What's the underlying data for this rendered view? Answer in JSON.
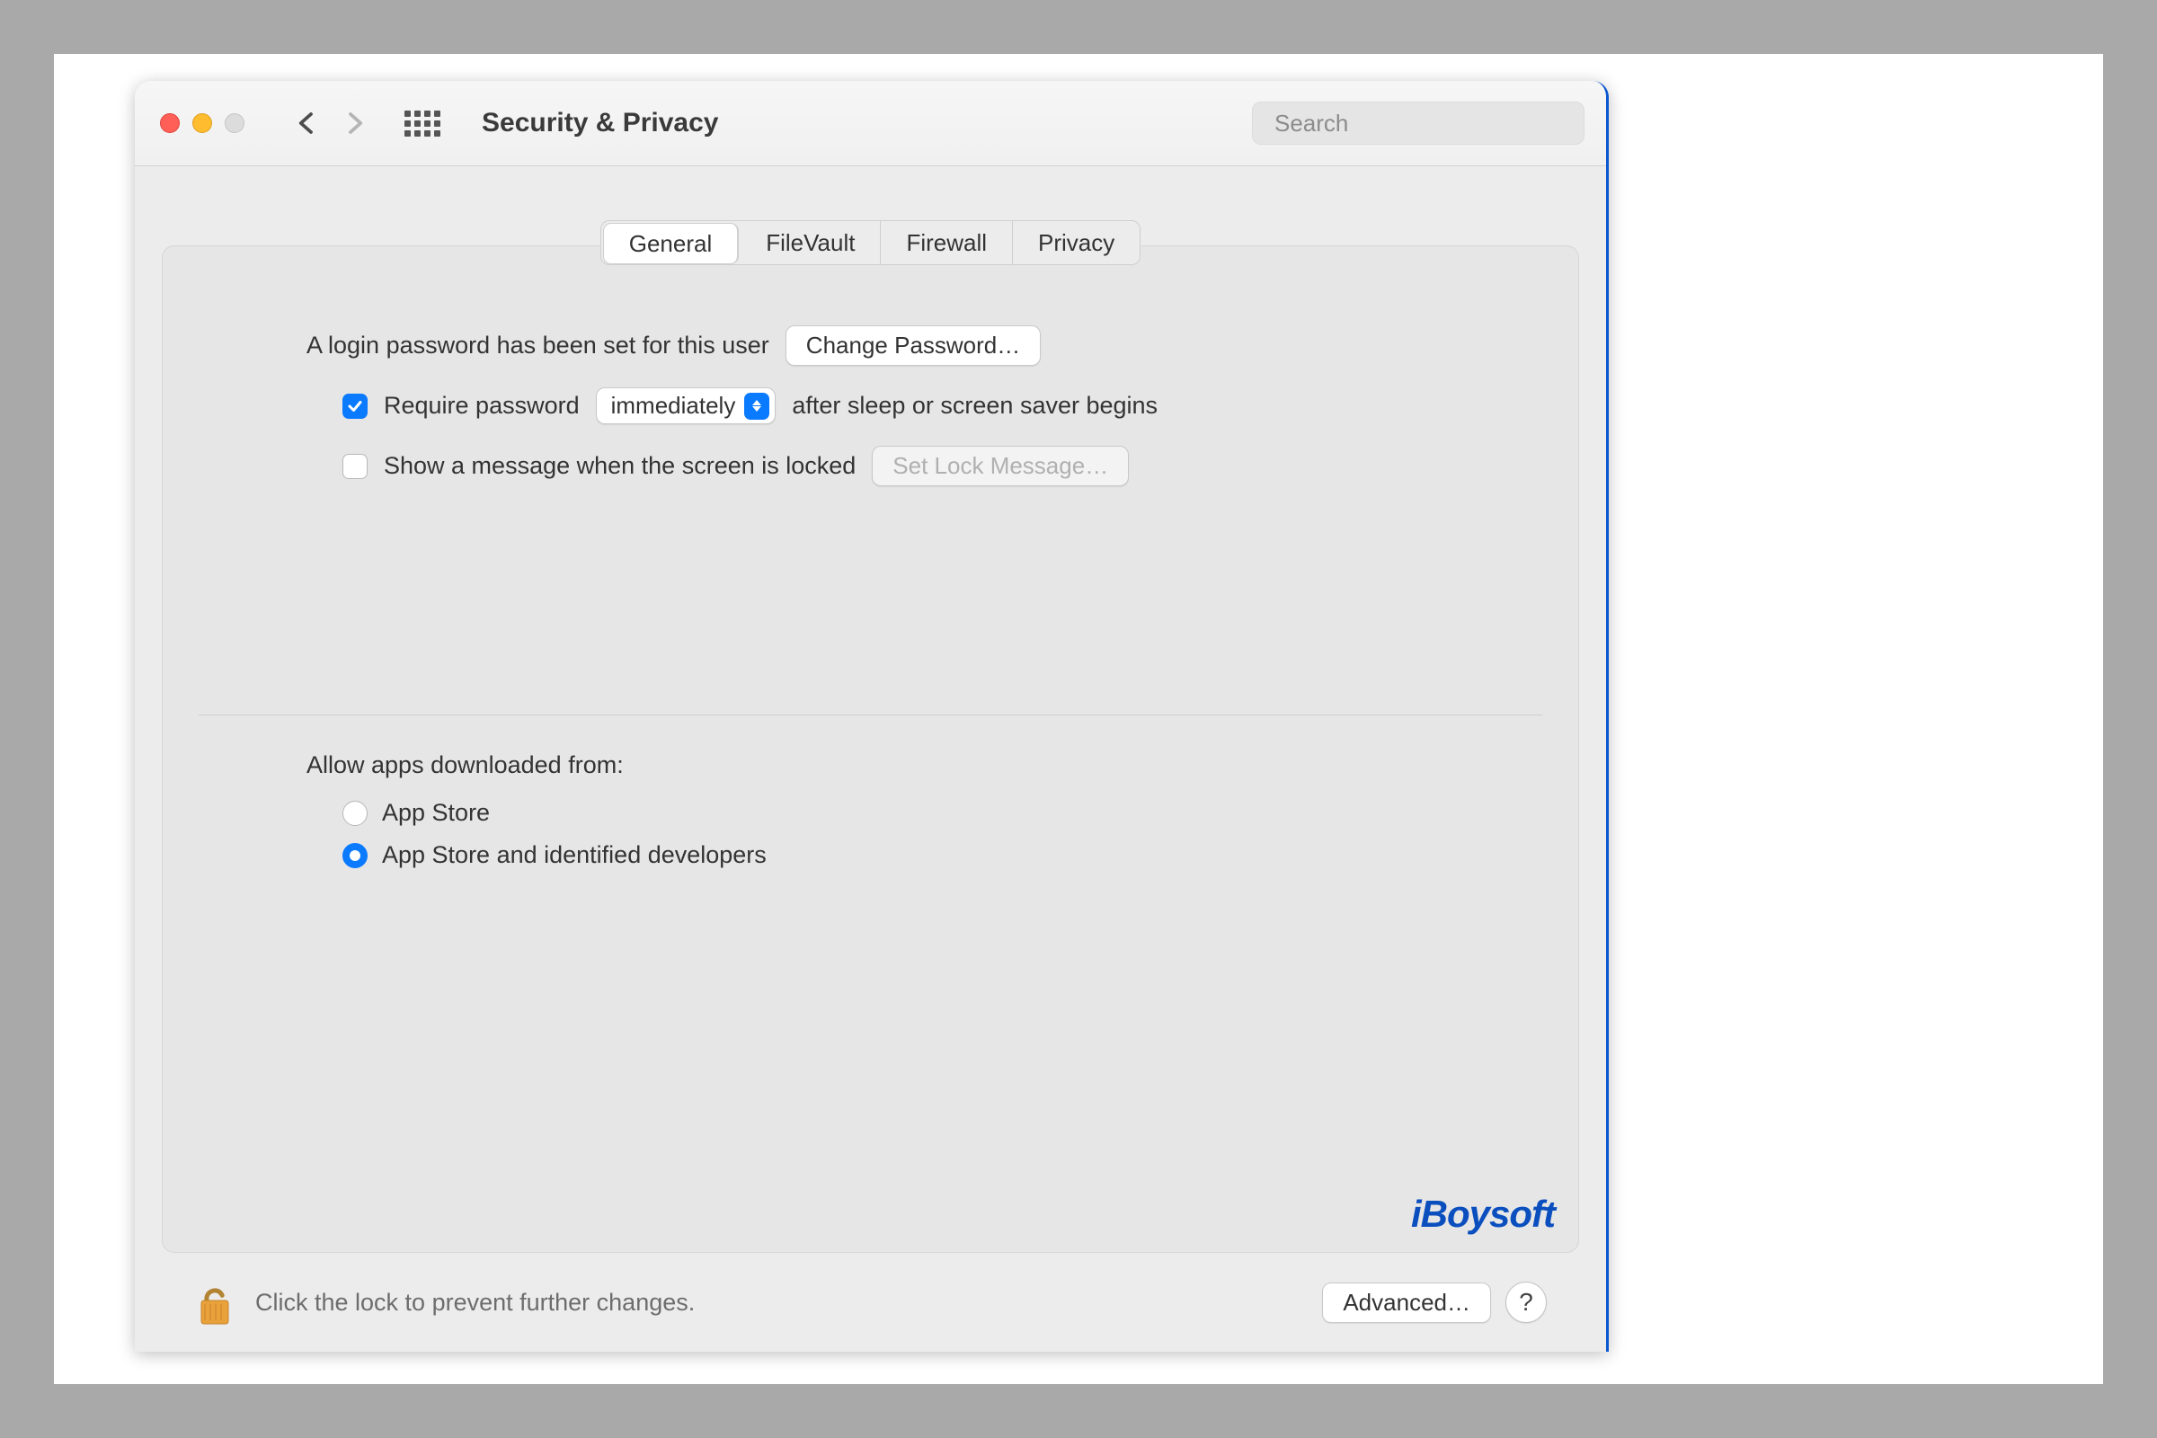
{
  "toolbar": {
    "title": "Security & Privacy",
    "search_placeholder": "Search"
  },
  "tabs": [
    "General",
    "FileVault",
    "Firewall",
    "Privacy"
  ],
  "active_tab": "General",
  "general": {
    "login_text": "A login password has been set for this user",
    "change_password_label": "Change Password…",
    "require_password_checked": true,
    "require_password_prefix": "Require password",
    "require_password_delay": "immediately",
    "require_password_suffix": "after sleep or screen saver begins",
    "show_message_checked": false,
    "show_message_label": "Show a message when the screen is locked",
    "set_lock_message_label": "Set Lock Message…",
    "allow_apps_label": "Allow apps downloaded from:",
    "allow_apps_options": [
      {
        "label": "App Store",
        "selected": false
      },
      {
        "label": "App Store and identified developers",
        "selected": true
      }
    ]
  },
  "footer": {
    "lock_text": "Click the lock to prevent further changes.",
    "advanced_label": "Advanced…"
  },
  "watermark": "iBoysoft"
}
